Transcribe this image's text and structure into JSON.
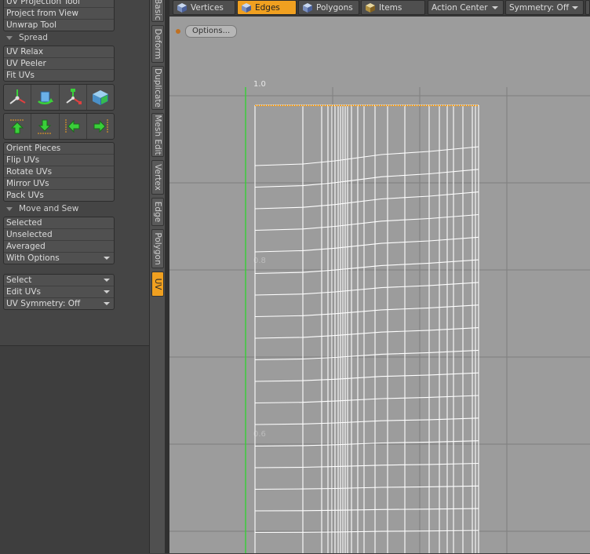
{
  "left_panel": {
    "top_tools": [
      "UV Projection Tool",
      "Project from View",
      "Unwrap Tool"
    ],
    "spread": {
      "header": "Spread",
      "tools": [
        "UV Relax",
        "UV Peeler",
        "Fit UVs"
      ]
    },
    "icon_row_1": [
      "transform-gizmo-icon",
      "rotate-gizmo-icon",
      "scale-gizmo-icon",
      "uv-box-icon"
    ],
    "icon_row_2": [
      "arrow-up-icon",
      "arrow-down-icon",
      "arrow-left-icon",
      "arrow-right-icon"
    ],
    "orient_tools": [
      "Orient Pieces",
      "Flip UVs",
      "Rotate UVs",
      "Mirror UVs",
      "Pack UVs"
    ],
    "move_and_sew": {
      "header": "Move and Sew",
      "tools": [
        "Selected",
        "Unselected",
        "Averaged"
      ],
      "dropdown": "With Options"
    },
    "dropdowns": [
      "Select",
      "Edit UVs",
      "UV Symmetry: Off"
    ]
  },
  "vertical_tabs": {
    "items": [
      "Basic",
      "Deform",
      "Duplicate",
      "Mesh Edit",
      "Vertex",
      "Edge",
      "Polygon",
      "UV"
    ],
    "active": "UV"
  },
  "top_toolbar": {
    "modes": [
      "Vertices",
      "Edges",
      "Polygons",
      "Items"
    ],
    "active_mode": "Edges",
    "action_center": "Action Center",
    "symmetry": "Symmetry: Off"
  },
  "viewport": {
    "options_label": "Options...",
    "axis_label_top": "1.0",
    "axis_label_mid": "0.8",
    "axis_label_low": "0.6"
  },
  "colors": {
    "accent": "#f0a020",
    "viewport_bg": "#9c9c9c",
    "uv_edge": "#ffffff",
    "v_axis": "#3ccc3c",
    "selected_edge": "#ff9a00"
  }
}
